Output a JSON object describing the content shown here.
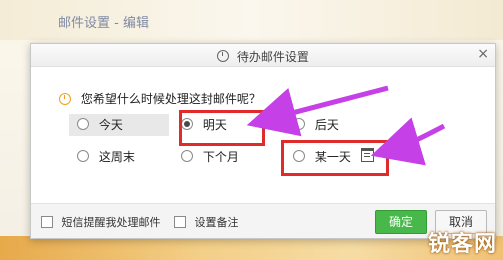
{
  "background": {
    "behind_text": "邮件设置 - 编辑"
  },
  "dialog": {
    "title": "待办邮件设置",
    "close_glyph": "×",
    "question": "您希望什么时候处理这封邮件呢？",
    "options": [
      {
        "label": "今天",
        "checked": false
      },
      {
        "label": "明天",
        "checked": true
      },
      {
        "label": "后天",
        "checked": false
      },
      {
        "label": "这周末",
        "checked": false
      },
      {
        "label": "下个月",
        "checked": false
      },
      {
        "label": "某一天",
        "checked": false
      }
    ],
    "footer": {
      "sms_label": "短信提醒我处理邮件",
      "note_label": "设置备注",
      "ok_label": "确定",
      "cancel_label": "取消"
    }
  },
  "watermark": "锐客网",
  "colors": {
    "highlight": "#e02b2b",
    "arrow": "#c540e6",
    "ok_button": "#48b84b"
  }
}
